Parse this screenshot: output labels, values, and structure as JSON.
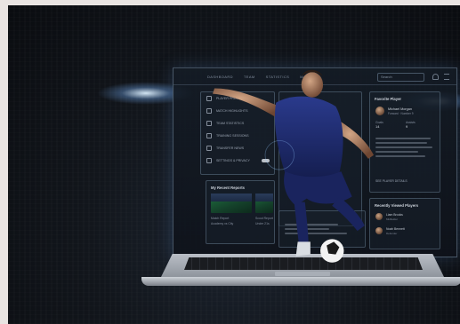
{
  "topbar": {
    "nav_items": [
      "DASHBOARD",
      "TEAM",
      "STATISTICS",
      "MATCHES"
    ],
    "search_placeholder": "Search"
  },
  "menu_panel": {
    "items": [
      "PLAYER PROFILE",
      "MATCH HIGHLIGHTS",
      "TEAM STATISTICS",
      "TRAINING SESSIONS",
      "TRANSFER NEWS",
      "SETTINGS & PRIVACY"
    ]
  },
  "recent_reports": {
    "title": "My Recent Reports",
    "cards": [
      {
        "line1": "Match Report",
        "line2": "Academy vs City"
      },
      {
        "line1": "Scout Report",
        "line2": "Under 21s"
      }
    ]
  },
  "favorite_panel": {
    "title": "Favorite Player",
    "player_name": "Michael Morgan",
    "player_role": "Forward · Number 9",
    "stats": [
      {
        "label": "Goals",
        "value": "14"
      },
      {
        "label": "Assists",
        "value": "9"
      }
    ],
    "link": "SEE PLAYER DETAILS"
  },
  "recent_viewed": {
    "title": "Recently Viewed Players",
    "players": [
      {
        "name": "Liam Brooks",
        "sub": "Midfielder"
      },
      {
        "name": "Noah Bennett",
        "sub": "Defender"
      }
    ]
  },
  "colors": {
    "glow": "#8fc4ff",
    "kit": "#1e2b6e",
    "background": "#0a0c10"
  }
}
